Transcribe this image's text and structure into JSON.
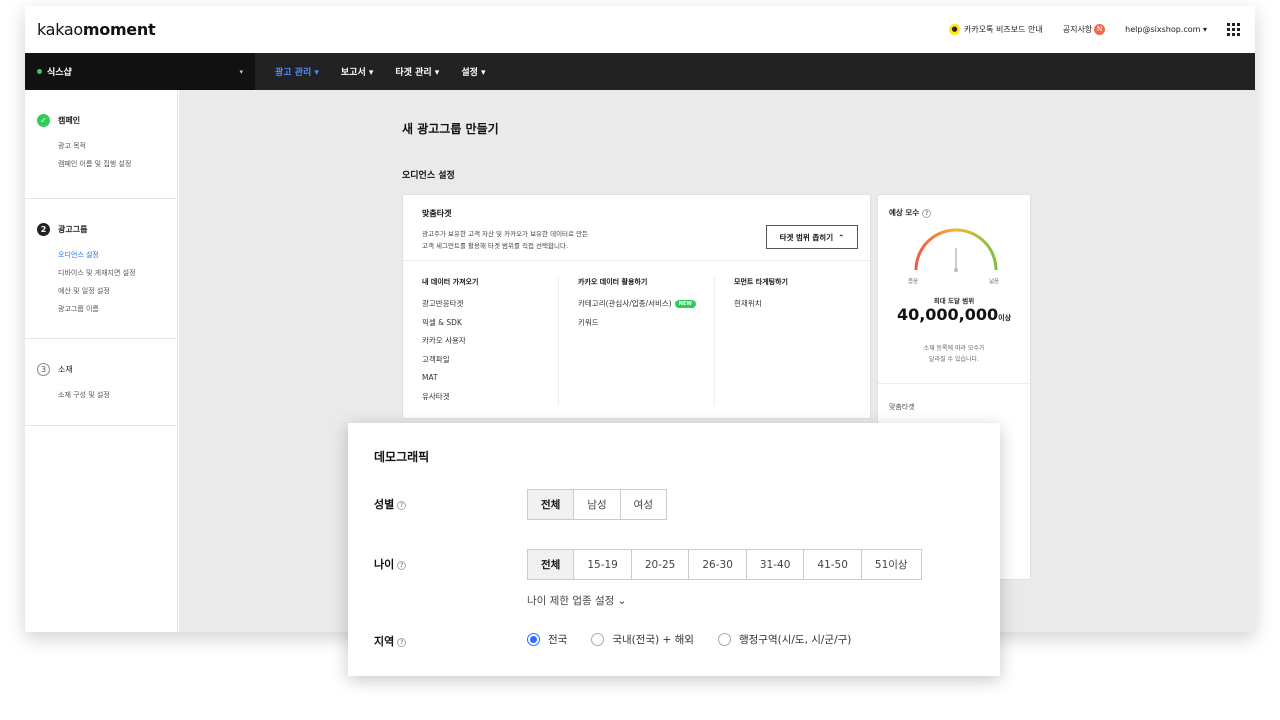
{
  "topbar": {
    "logo_prefix": "kakao",
    "logo_suffix": "moment",
    "bizboard": "카카오톡 비즈보드 안내",
    "kakao_glyph": "●",
    "notice": "공지사항",
    "notice_badge": "N",
    "account": "help@sixshop.com",
    "account_caret": "▾"
  },
  "navbar": {
    "account_name": "식스샵",
    "caret": "▾",
    "menus": [
      "광고 관리 ▾",
      "보고서 ▾",
      "타겟 관리 ▾",
      "설정 ▾"
    ]
  },
  "sidebar": {
    "sections": [
      {
        "icon": "✓",
        "title": "캠페인",
        "items": [
          "광고 목적",
          "캠페인 이름 및 집행 설정"
        ]
      },
      {
        "icon": "2",
        "title": "광고그룹",
        "items": [
          "오디언스 설정",
          "디바이스 및 게재지면 설정",
          "예산 및 일정 설정",
          "광고그룹 이름"
        ]
      },
      {
        "icon": "3",
        "title": "소재",
        "items": [
          "소재 구성 및 설정"
        ]
      }
    ]
  },
  "main": {
    "title": "새 광고그룹 만들기",
    "section_title": "오디언스 설정",
    "target_card": {
      "title": "맞춤타겟",
      "desc_line1": "광고주가 보유한 고객 자산 및 카카오가 보유한 데이터로 만든",
      "desc_line2": "고객 세그먼트를 활용해 타겟 범위를 직접 선택합니다.",
      "button": "타겟 범위 좁히기",
      "button_icon": "⌃",
      "columns": [
        {
          "title": "내 데이터 가져오기",
          "items": [
            "광고반응타겟",
            "픽셀 & SDK",
            "카카오 사용자",
            "고객파일",
            "MAT",
            "유사타겟"
          ]
        },
        {
          "title": "카카오 데이터 활용하기",
          "items": [
            "카테고리(관심사/업종/서비스)",
            "키워드"
          ],
          "new_badge": "NEW"
        },
        {
          "title": "모먼트 타게팅하기",
          "items": [
            "현재위치"
          ]
        }
      ]
    },
    "estimate": {
      "title": "예상 모수",
      "help": "?",
      "label_low": "좁음",
      "label_high": "넓음",
      "caption": "최대 도달 범위",
      "value": "40,000,000",
      "value_suffix": "이상",
      "note_line1": "소재 등록에 따라 모수가",
      "note_line2": "달라질 수 있습니다.",
      "sub": "맞춤타겟",
      "gauge_level": 0.5
    },
    "scroll_top": "▲"
  },
  "demographic": {
    "title": "데모그래픽",
    "help": "?",
    "gender": {
      "label": "성별",
      "options": [
        "전체",
        "남성",
        "여성"
      ],
      "selected": "전체"
    },
    "age": {
      "label": "나이",
      "options": [
        "전체",
        "15-19",
        "20-25",
        "26-30",
        "31-40",
        "41-50",
        "51이상"
      ],
      "selected": "전체"
    },
    "age_link": "나이 제한 업종 설정",
    "age_link_icon": "⌄",
    "region": {
      "label": "지역",
      "options": [
        "전국",
        "국내(전국) + 해외",
        "행정구역(시/도, 시/군/구)"
      ],
      "selected": "전국"
    }
  },
  "colors": {
    "accent": "#2a6dff",
    "nav_bg": "#222222",
    "green": "#2fcd5a"
  }
}
